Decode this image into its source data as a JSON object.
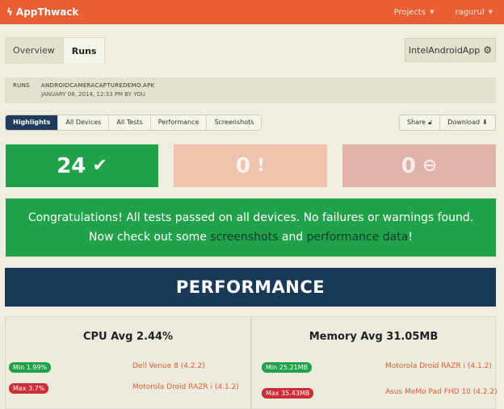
{
  "header": {
    "brand": "AppThwack",
    "projects": "Projects",
    "user": "ragurul"
  },
  "tabs": [
    {
      "label": "Overview",
      "active": false
    },
    {
      "label": "Runs",
      "active": true
    }
  ],
  "app_button": {
    "label": "IntelAndroidApp"
  },
  "breadcrumb": {
    "root": "RUNS",
    "file": "ANDROIDCAMERACAPTUREDEMO.APK",
    "date": "JANUARY 08, 2014, 12:33 PM BY YOU"
  },
  "subtabs": [
    {
      "label": "Highlights",
      "active": true
    },
    {
      "label": "All Devices",
      "active": false
    },
    {
      "label": "All Tests",
      "active": false
    },
    {
      "label": "Performance",
      "active": false
    },
    {
      "label": "Screenshots",
      "active": false
    }
  ],
  "actions": {
    "share": "Share",
    "download": "Download"
  },
  "stats": {
    "passed": "24",
    "warnings": "0",
    "failures": "0"
  },
  "banner": {
    "line1": "Congratulations! All tests passed on all devices. No failures or warnings found.",
    "line2_pre": "Now check out some ",
    "link1": "screenshots",
    "mid": " and ",
    "link2": "performance data",
    "end": "!"
  },
  "performance": {
    "title": "PERFORMANCE",
    "cpu": {
      "title": "CPU Avg 2.44%",
      "min_label": "Min 1.99%",
      "min_device": "Dell Venue 8 (4.2.2)",
      "max_label": "Max 3.7%",
      "max_device": "Motorola Droid RAZR i (4.1.2)"
    },
    "memory": {
      "title": "Memory Avg 31.05MB",
      "min_label": "Min 25.21MB",
      "min_device": "Motorola Droid RAZR i (4.1.2)",
      "max_label": "Max 35.43MB",
      "max_device": "Asus MeMo Pad FHD 10 (4.2.2)"
    }
  },
  "colors": {
    "accent": "#e95e35",
    "success": "#21a24a",
    "navy": "#1a3957",
    "danger": "#cc2d36"
  }
}
